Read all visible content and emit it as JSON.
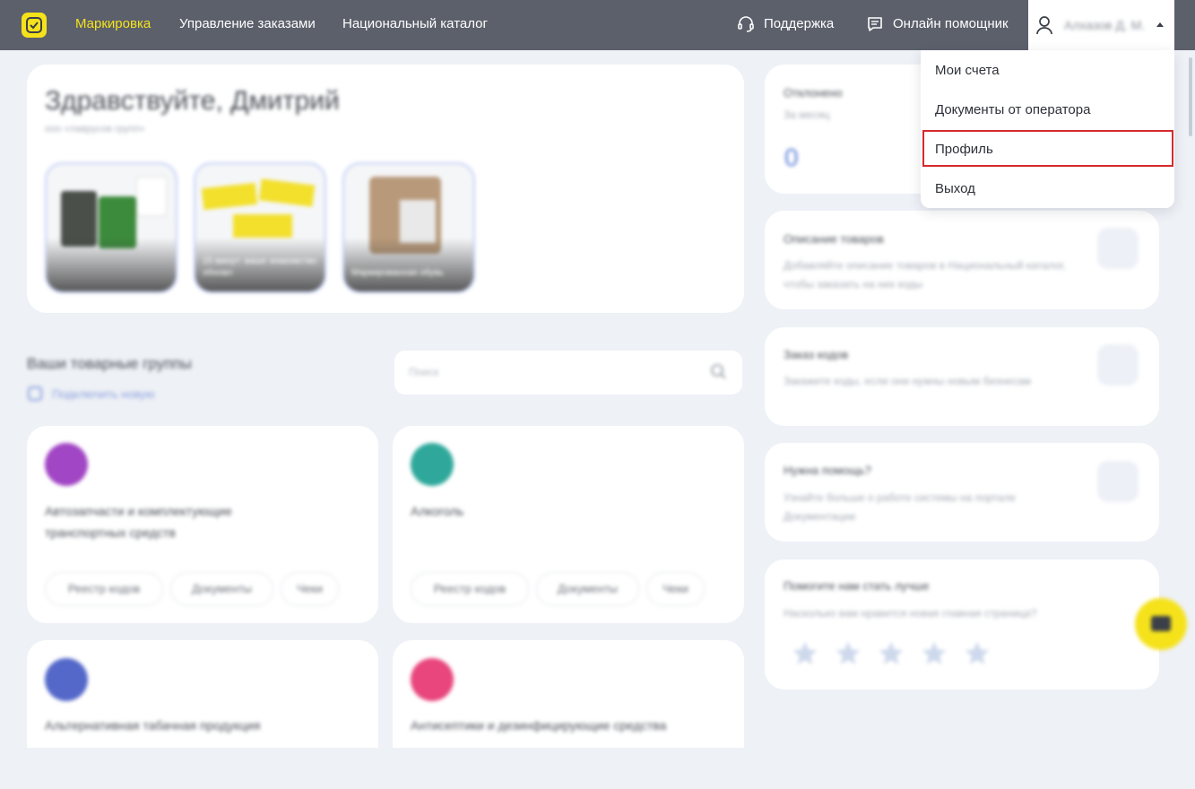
{
  "header": {
    "nav": [
      {
        "label": "Маркировка",
        "active": true
      },
      {
        "label": "Управление заказами",
        "active": false
      },
      {
        "label": "Национальный каталог",
        "active": false
      }
    ],
    "support_label": "Поддержка",
    "assistant_label": "Онлайн помощник",
    "user_name": "Алхазов Д. М."
  },
  "user_menu": {
    "items": [
      "Мои счета",
      "Документы от оператора",
      "Профиль",
      "Выход"
    ],
    "highlighted": "Профиль"
  },
  "greeting": {
    "title": "Здравствуйте, Дмитрий",
    "subtitle": "ооо «лаврусов групп»",
    "stories": [
      {
        "caption": ""
      },
      {
        "caption": "15 минут: ваше знакомство обновл"
      },
      {
        "caption": "Маркированная обувь"
      }
    ]
  },
  "groups": {
    "title": "Ваши товарные группы",
    "link": "Подключить новую",
    "search_placeholder": "Поиск",
    "items": [
      {
        "name": "Автозапчасти и комплектующие транспортных средств",
        "color": "#a146c4",
        "chips": [
          "Реестр кодов",
          "Документы",
          "Чеки"
        ]
      },
      {
        "name": "Алкоголь",
        "color": "#2fa89b",
        "chips": [
          "Реестр кодов",
          "Документы",
          "Чеки"
        ]
      },
      {
        "name": "Альтернативная табачная продукция",
        "color": "#5468c9",
        "chips": []
      },
      {
        "name": "Антисептики и дезинфицирующие средства",
        "color": "#e8467c",
        "chips": []
      }
    ]
  },
  "sidebar": {
    "stats_title": "Отклонено",
    "stats_sub": "За месяц",
    "stats_value": "0",
    "cards": [
      {
        "title": "Описание товаров",
        "text": "Добавляйте описание товаров в Национальный каталог, чтобы заказать на них коды"
      },
      {
        "title": "Заказ кодов",
        "text": "Закажите коды, если они нужны новым бизнесам"
      },
      {
        "title": "Нужна помощь?",
        "text": "Узнайте больше о работе системы на портале Документации"
      }
    ],
    "rating": {
      "title": "Помогите нам стать лучше",
      "text": "Насколько вам нравится новая главная страница?",
      "stars": 5
    }
  },
  "colors": {
    "accent": "#f5e21b",
    "topbar": "#5b606b",
    "highlight": "#d52a2f"
  }
}
